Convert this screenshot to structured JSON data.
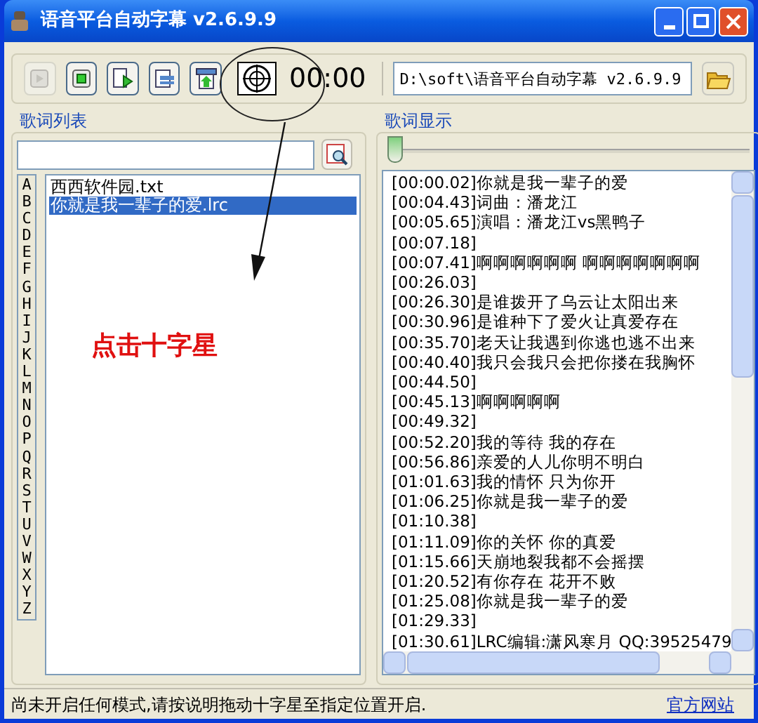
{
  "window": {
    "title": "语音平台自动字幕 v2.6.9.9"
  },
  "toolbar": {
    "buttons": [
      {
        "kind": "play",
        "disabled": true
      },
      {
        "kind": "stop",
        "disabled": false
      },
      {
        "kind": "play-file",
        "disabled": false
      },
      {
        "kind": "swap",
        "disabled": false
      },
      {
        "kind": "upload",
        "disabled": false
      },
      {
        "kind": "crosshair",
        "disabled": false
      }
    ],
    "time": "00:00",
    "path": "D:\\soft\\语音平台自动字幕 v2.6.9.9"
  },
  "lyrics_list": {
    "title": "歌词列表",
    "letters": [
      "A",
      "B",
      "C",
      "D",
      "E",
      "F",
      "G",
      "H",
      "I",
      "J",
      "K",
      "L",
      "M",
      "N",
      "O",
      "P",
      "Q",
      "R",
      "S",
      "T",
      "U",
      "V",
      "W",
      "X",
      "Y",
      "Z"
    ],
    "files": [
      {
        "name": "西西软件园.txt",
        "selected": false
      },
      {
        "name": "你就是我一辈子的爱.lrc",
        "selected": true
      }
    ]
  },
  "annotation": {
    "text": "点击十字星"
  },
  "lyrics_display": {
    "title": "歌词显示",
    "level": 0,
    "lines": [
      "[00:00.02]你就是我一辈子的爱",
      "[00:04.43]词曲：潘龙江",
      "[00:05.65]演唱：潘龙江vs黑鸭子",
      "[00:07.18]",
      "[00:07.41]啊啊啊啊啊啊 啊啊啊啊啊啊啊",
      "[00:26.03]",
      "[00:26.30]是谁拨开了乌云让太阳出来",
      "[00:30.96]是谁种下了爱火让真爱存在",
      "[00:35.70]老天让我遇到你逃也逃不出来",
      "[00:40.40]我只会我只会把你搂在我胸怀",
      "[00:44.50]",
      "[00:45.13]啊啊啊啊啊",
      "[00:49.32]",
      "[00:52.20]我的等待 我的存在",
      "[00:56.86]亲爱的人儿你明不明白",
      "[01:01.63]我的情怀 只为你开",
      "[01:06.25]你就是我一辈子的爱",
      "[01:10.38]",
      "[01:11.09]你的关怀 你的真爱",
      "[01:15.66]天崩地裂我都不会摇摆",
      "[01:20.52]有你存在 花开不败",
      "[01:25.08]你就是我一辈子的爱",
      "[01:29.33]",
      "[01:30.61]LRC编辑:潇风寒月 QQ:39525479"
    ]
  },
  "status_bar": {
    "message": "尚未开启任何模式,请按说明拖动十字星至指定位置开启.",
    "link": "官方网站"
  }
}
